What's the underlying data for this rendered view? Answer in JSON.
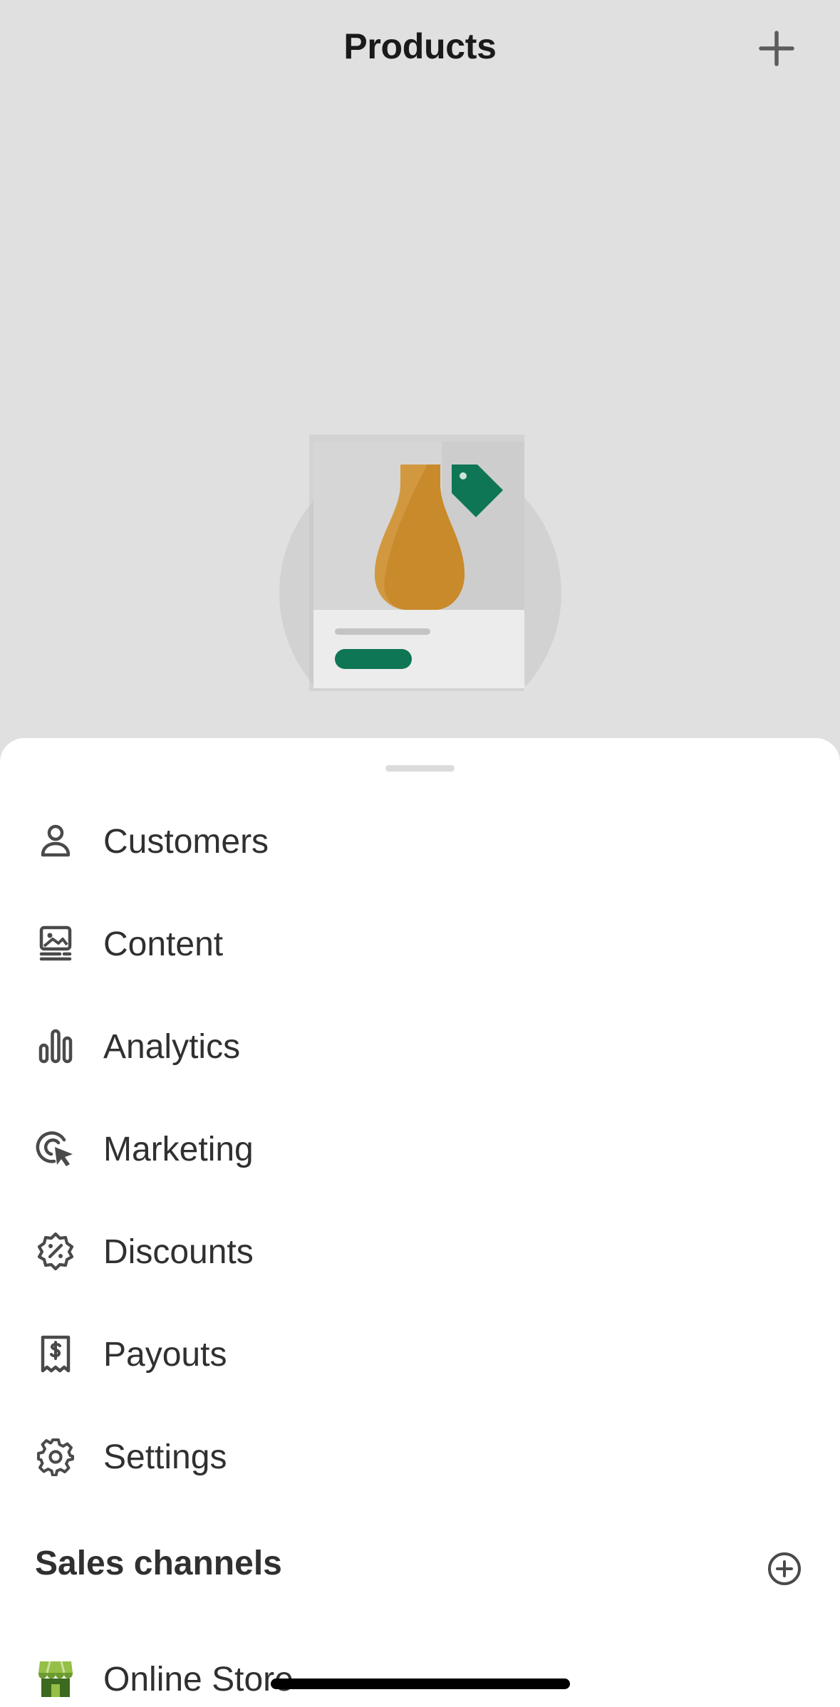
{
  "header": {
    "title": "Products",
    "add_icon": "plus-icon"
  },
  "illustration": {
    "icon": "product-vase-tag-illustration"
  },
  "menu": {
    "items": [
      {
        "label": "Customers",
        "icon": "person-icon"
      },
      {
        "label": "Content",
        "icon": "image-content-icon"
      },
      {
        "label": "Analytics",
        "icon": "bar-chart-icon"
      },
      {
        "label": "Marketing",
        "icon": "target-cursor-icon"
      },
      {
        "label": "Discounts",
        "icon": "discount-badge-icon"
      },
      {
        "label": "Payouts",
        "icon": "receipt-dollar-icon"
      },
      {
        "label": "Settings",
        "icon": "gear-icon"
      }
    ]
  },
  "sales_channels": {
    "title": "Sales channels",
    "add_icon": "plus-circle-icon",
    "items": [
      {
        "label": "Online Store",
        "icon": "storefront-icon"
      }
    ]
  },
  "colors": {
    "background": "#e0e0e0",
    "sheet": "#ffffff",
    "text": "#303030",
    "brand_green": "#0e7654",
    "vase": "#c98a2b"
  }
}
